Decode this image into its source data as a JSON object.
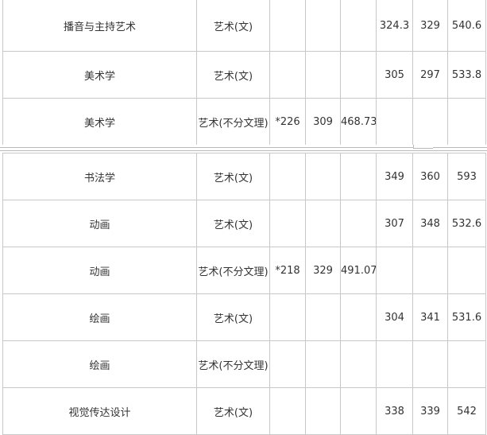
{
  "top_rows": [
    [
      "播音与主持艺术",
      "艺术(文)",
      "",
      "",
      "",
      "324.3",
      "329",
      "540.6"
    ],
    [
      "美术学",
      "艺术(文)",
      "",
      "",
      "",
      "305",
      "297",
      "533.8"
    ],
    [
      "美术学",
      "艺术(不分文理)",
      "*226",
      "309",
      "468.73",
      "",
      "",
      ""
    ]
  ],
  "bottom_rows": [
    [
      "书法学",
      "艺术(文)",
      "",
      "",
      "",
      "349",
      "360",
      "593"
    ],
    [
      "动画",
      "艺术(文)",
      "",
      "",
      "",
      "307",
      "348",
      "532.6"
    ],
    [
      "动画",
      "艺术(不分文理)",
      "*218",
      "329",
      "491.07",
      "",
      "",
      ""
    ],
    [
      "绘画",
      "艺术(文)",
      "",
      "",
      "",
      "304",
      "341",
      "531.6"
    ],
    [
      "绘画",
      "艺术(不分文理)",
      "",
      "",
      "",
      "",
      "",
      ""
    ],
    [
      "视觉传达设计",
      "艺术(文)",
      "",
      "",
      "",
      "338",
      "339",
      "542"
    ]
  ]
}
